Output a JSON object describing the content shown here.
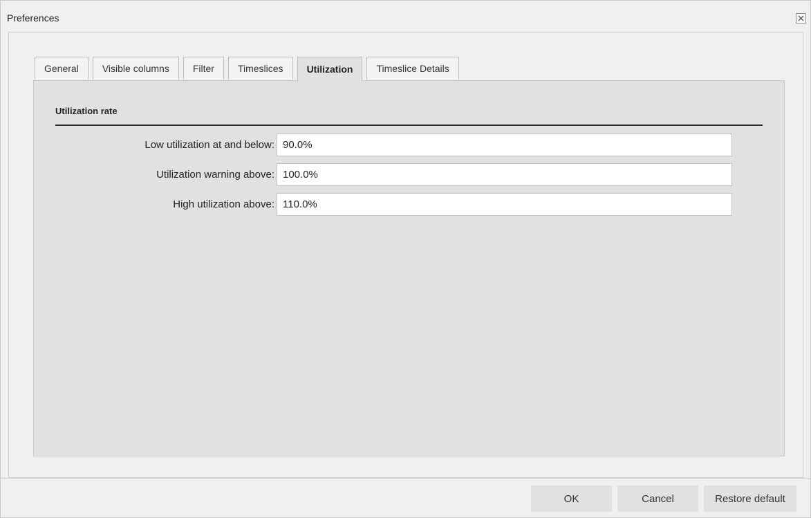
{
  "window": {
    "title": "Preferences",
    "close_icon": "close-icon"
  },
  "tabs": [
    {
      "label": "General",
      "active": false
    },
    {
      "label": "Visible columns",
      "active": false
    },
    {
      "label": "Filter",
      "active": false
    },
    {
      "label": "Timeslices",
      "active": false
    },
    {
      "label": "Utilization",
      "active": true
    },
    {
      "label": "Timeslice Details",
      "active": false
    }
  ],
  "section": {
    "title": "Utilization rate"
  },
  "fields": [
    {
      "label": "Low utilization at and below:",
      "value": "90.0%"
    },
    {
      "label": "Utilization warning above:",
      "value": "100.0%"
    },
    {
      "label": "High utilization above:",
      "value": "110.0%"
    }
  ],
  "footer": {
    "ok_label": "OK",
    "cancel_label": "Cancel",
    "restore_label": "Restore default"
  },
  "colors": {
    "dialog_bg": "#f0f0f0",
    "panel_bg": "#e1e1e1",
    "button_bg": "#e1e1e1"
  }
}
